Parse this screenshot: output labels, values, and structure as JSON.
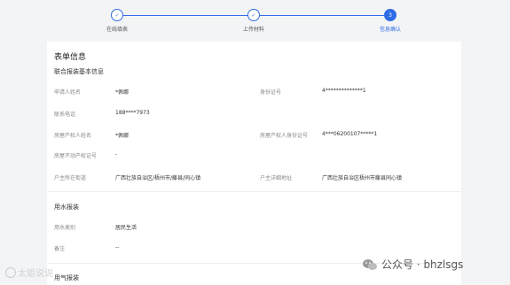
{
  "stepper": {
    "steps": [
      {
        "label": "在线填表",
        "state": "done",
        "mark": "✓"
      },
      {
        "label": "上传材料",
        "state": "done",
        "mark": "✓"
      },
      {
        "label": "信息确认",
        "state": "active",
        "mark": "3"
      }
    ],
    "accent": "#2f6ce5"
  },
  "form": {
    "title": "表单信息",
    "section1": {
      "title": "联合报装基本信息",
      "applicant_name_label": "申请人姓名",
      "applicant_name": "*佩娜",
      "id_number_label": "身份证号",
      "id_number": "4**************1",
      "phone_label": "联系电话",
      "phone": "188****7973",
      "owner_name_label": "房屋产权人姓名",
      "owner_name": "*佩娜",
      "owner_id_label": "房屋产权人身份证号",
      "owner_id": "4***06200107*****1",
      "property_cert_label": "房屋不动产权证号",
      "property_cert": "-",
      "street_label": "户主所在街道",
      "street": "广西壮族自治区/梧州市/藤县/同心镇",
      "address_label": "户主详细地址",
      "address": "广西壮族自治区梧州市藤县同心镇"
    },
    "section2": {
      "title": "用水报装",
      "water_type_label": "用水类别",
      "water_type": "居民生活",
      "remark_label": "备注",
      "remark": "--"
    },
    "section3": {
      "title": "用气报装"
    }
  },
  "watermark": {
    "left_text": "太姐说说",
    "right_text": "公众号 · bhzlsgs"
  }
}
